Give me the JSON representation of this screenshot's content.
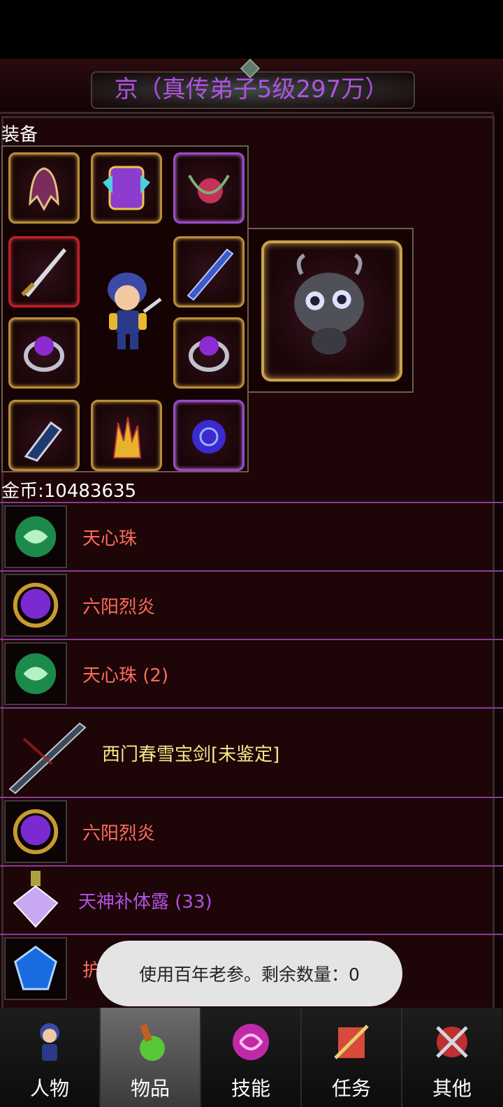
{
  "header": {
    "title": "京（真传弟子5级297万）"
  },
  "equipment": {
    "label": "装备"
  },
  "gold": {
    "text": "金币:10483635"
  },
  "inventory": [
    {
      "name": "天心珠",
      "icon": "green-orb-icon",
      "color": "red"
    },
    {
      "name": "六阳烈炎",
      "icon": "purple-gem-icon",
      "color": "red"
    },
    {
      "name": "天心珠 (2)",
      "icon": "green-orb-icon",
      "color": "red"
    },
    {
      "name": "西门春雪宝剑[未鉴定]",
      "icon": "sword-icon",
      "color": "yellow"
    },
    {
      "name": "六阳烈炎",
      "icon": "purple-gem-icon",
      "color": "red"
    },
    {
      "name": "天神补体露 (33)",
      "icon": "potion-flask-icon",
      "color": "purple"
    },
    {
      "name": "护身符",
      "icon": "blue-crystal-icon",
      "color": "red"
    }
  ],
  "toast": {
    "text": "使用百年老参。剩余数量：0"
  },
  "tabs": [
    {
      "label": "人物",
      "icon": "character-icon",
      "active": false
    },
    {
      "label": "物品",
      "icon": "potion-bag-icon",
      "active": true
    },
    {
      "label": "技能",
      "icon": "skill-swirl-icon",
      "active": false
    },
    {
      "label": "任务",
      "icon": "quest-scroll-icon",
      "active": false
    },
    {
      "label": "其他",
      "icon": "crossed-swords-icon",
      "active": false
    }
  ],
  "colors": {
    "title": "#b152e4",
    "item_red": "#ff6b5a",
    "item_yellow": "#f4e98a",
    "item_purple": "#b152e4",
    "divider": "#8a3aa0"
  }
}
